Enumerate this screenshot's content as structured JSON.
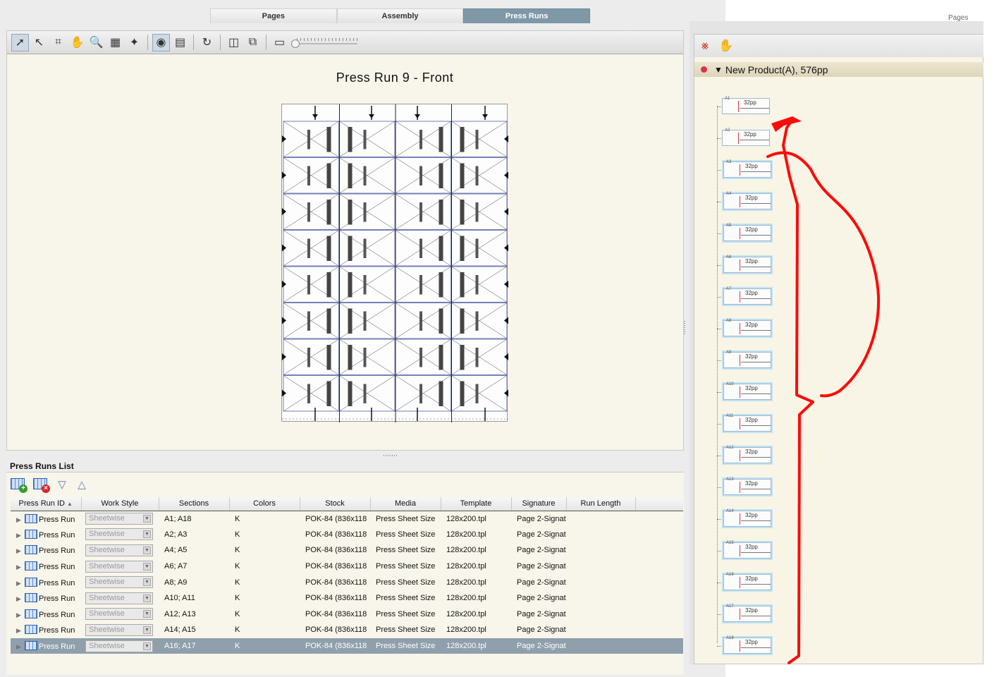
{
  "tabs": [
    "Pages",
    "Assembly",
    "Press Runs"
  ],
  "active_tab": "Press Runs",
  "page_stub": "Pages",
  "toolbar_icons": [
    "select-arrow-icon",
    "pointer-icon",
    "crop-marks-icon",
    "hand-icon",
    "zoom-icon",
    "layout-grid-icon",
    "auto-impose-icon",
    "preview-eye-icon",
    "ruler-icon",
    "refresh-icon",
    "split-view-icon",
    "group-icon",
    "monitor-icon"
  ],
  "press_run_title": "Press Run 9 - Front",
  "list": {
    "title": "Press Runs List",
    "columns": [
      "Press Run ID",
      "Work Style",
      "Sections",
      "Colors",
      "Stock",
      "Media",
      "Template",
      "Signature",
      "Run Length"
    ],
    "sort_indicator": "▲",
    "rows": [
      {
        "id": "Press Run",
        "work_style": "Sheetwise",
        "sections": "A1; A18",
        "colors": "K",
        "stock": "POK-84 (836x118",
        "media": "Press Sheet Size",
        "template": "128x200.tpl",
        "signature": "Page 2-Signat",
        "run_length": ""
      },
      {
        "id": "Press Run",
        "work_style": "Sheetwise",
        "sections": "A2; A3",
        "colors": "K",
        "stock": "POK-84 (836x118",
        "media": "Press Sheet Size",
        "template": "128x200.tpl",
        "signature": "Page 2-Signat",
        "run_length": ""
      },
      {
        "id": "Press Run",
        "work_style": "Sheetwise",
        "sections": "A4; A5",
        "colors": "K",
        "stock": "POK-84 (836x118",
        "media": "Press Sheet Size",
        "template": "128x200.tpl",
        "signature": "Page 2-Signat",
        "run_length": ""
      },
      {
        "id": "Press Run",
        "work_style": "Sheetwise",
        "sections": "A6; A7",
        "colors": "K",
        "stock": "POK-84 (836x118",
        "media": "Press Sheet Size",
        "template": "128x200.tpl",
        "signature": "Page 2-Signat",
        "run_length": ""
      },
      {
        "id": "Press Run",
        "work_style": "Sheetwise",
        "sections": "A8; A9",
        "colors": "K",
        "stock": "POK-84 (836x118",
        "media": "Press Sheet Size",
        "template": "128x200.tpl",
        "signature": "Page 2-Signat",
        "run_length": ""
      },
      {
        "id": "Press Run",
        "work_style": "Sheetwise",
        "sections": "A10; A11",
        "colors": "K",
        "stock": "POK-84 (836x118",
        "media": "Press Sheet Size",
        "template": "128x200.tpl",
        "signature": "Page 2-Signat",
        "run_length": ""
      },
      {
        "id": "Press Run",
        "work_style": "Sheetwise",
        "sections": "A12; A13",
        "colors": "K",
        "stock": "POK-84 (836x118",
        "media": "Press Sheet Size",
        "template": "128x200.tpl",
        "signature": "Page 2-Signat",
        "run_length": ""
      },
      {
        "id": "Press Run",
        "work_style": "Sheetwise",
        "sections": "A14; A15",
        "colors": "K",
        "stock": "POK-84 (836x118",
        "media": "Press Sheet Size",
        "template": "128x200.tpl",
        "signature": "Page 2-Signat",
        "run_length": ""
      },
      {
        "id": "Press Run",
        "work_style": "Sheetwise",
        "sections": "A16; A17",
        "colors": "K",
        "stock": "POK-84 (836x118",
        "media": "Press Sheet Size",
        "template": "128x200.tpl",
        "signature": "Page 2-Signat",
        "run_length": "",
        "selected": true
      }
    ]
  },
  "right_panel": {
    "product": "New Product(A), 576pp",
    "signatures": [
      {
        "label": "A1",
        "pages": "32pp"
      },
      {
        "label": "A2",
        "pages": "32pp"
      },
      {
        "label": "A3",
        "pages": "32pp"
      },
      {
        "label": "A4",
        "pages": "32pp"
      },
      {
        "label": "A5",
        "pages": "32pp"
      },
      {
        "label": "A6",
        "pages": "32pp"
      },
      {
        "label": "A7",
        "pages": "32pp"
      },
      {
        "label": "A8",
        "pages": "32pp"
      },
      {
        "label": "A9",
        "pages": "32pp"
      },
      {
        "label": "A10",
        "pages": "32pp"
      },
      {
        "label": "A11",
        "pages": "32pp"
      },
      {
        "label": "A12",
        "pages": "32pp"
      },
      {
        "label": "A13",
        "pages": "32pp"
      },
      {
        "label": "A14",
        "pages": "32pp"
      },
      {
        "label": "A15",
        "pages": "32pp"
      },
      {
        "label": "A16",
        "pages": "32pp"
      },
      {
        "label": "A17",
        "pages": "32pp"
      },
      {
        "label": "A18",
        "pages": "32pp"
      }
    ]
  },
  "colors": {
    "active_tab": "#7f98a8",
    "selected_row": "#8fa0ac",
    "annotation": "#ff0000",
    "panel_bg": "#f8f5ea"
  }
}
